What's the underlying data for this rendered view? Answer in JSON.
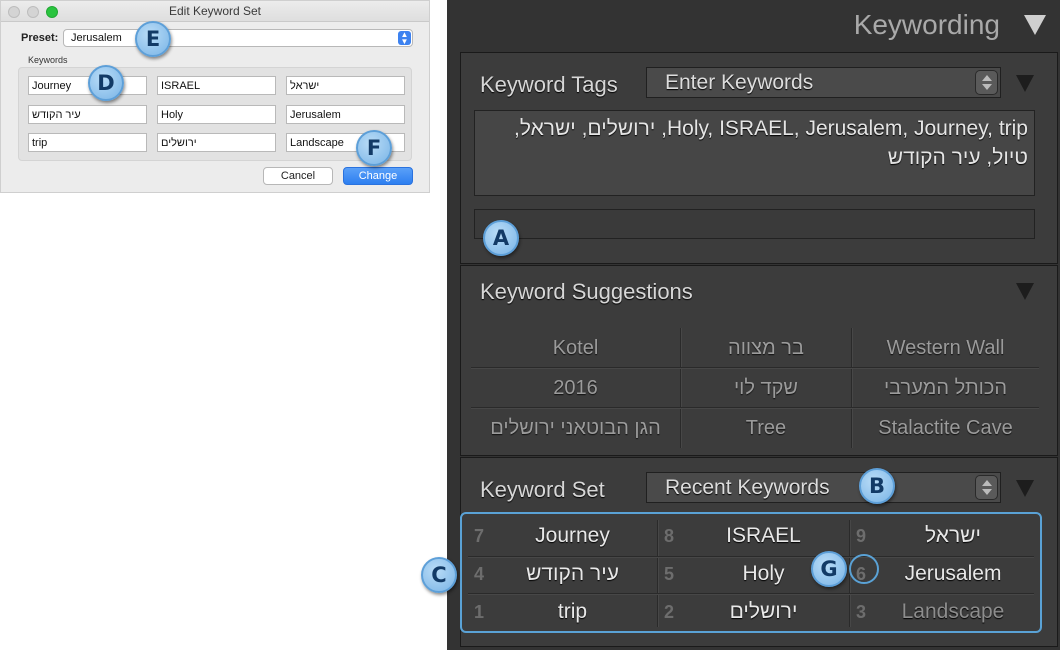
{
  "dialog": {
    "title": "Edit Keyword Set",
    "preset_label": "Preset:",
    "preset_value": "Jerusalem",
    "keywords_label": "Keywords",
    "fields": [
      "Journey",
      "ISRAEL",
      "ישראל",
      "עיר הקודש",
      "Holy",
      "Jerusalem",
      "trip",
      "ירושלים",
      "Landscape"
    ],
    "cancel_label": "Cancel",
    "change_label": "Change",
    "accent_color": "#2d7ff0"
  },
  "panel": {
    "title": "Keywording",
    "keyword_tags": {
      "header": "Keyword Tags",
      "mode": "Enter Keywords",
      "tags_text": "Holy, ISRAEL, Jerusalem, Journey, trip, ירושלים, ישראל, טיול, עיר הקודש"
    },
    "suggestions": {
      "header": "Keyword Suggestions",
      "items": [
        "Kotel",
        "בר מצווה",
        "Western Wall",
        "2016",
        "שקד לוי",
        "הכותל המערבי",
        "הגן הבוטאני ירושלים",
        "Tree",
        "Stalactite Cave"
      ]
    },
    "keyword_set": {
      "header": "Keyword Set",
      "mode": "Recent Keywords",
      "items": [
        {
          "num": "7",
          "kw": "Journey"
        },
        {
          "num": "8",
          "kw": "ISRAEL"
        },
        {
          "num": "9",
          "kw": "ישראל"
        },
        {
          "num": "4",
          "kw": "עיר הקודש"
        },
        {
          "num": "5",
          "kw": "Holy"
        },
        {
          "num": "6",
          "kw": "Jerusalem"
        },
        {
          "num": "1",
          "kw": "trip"
        },
        {
          "num": "2",
          "kw": "ירושלים"
        },
        {
          "num": "3",
          "kw": "Landscape"
        }
      ]
    }
  },
  "callouts": {
    "a": "A",
    "b": "B",
    "c": "C",
    "d": "D",
    "e": "E",
    "f": "F",
    "g": "G"
  },
  "callout_color": "#79b4e6"
}
